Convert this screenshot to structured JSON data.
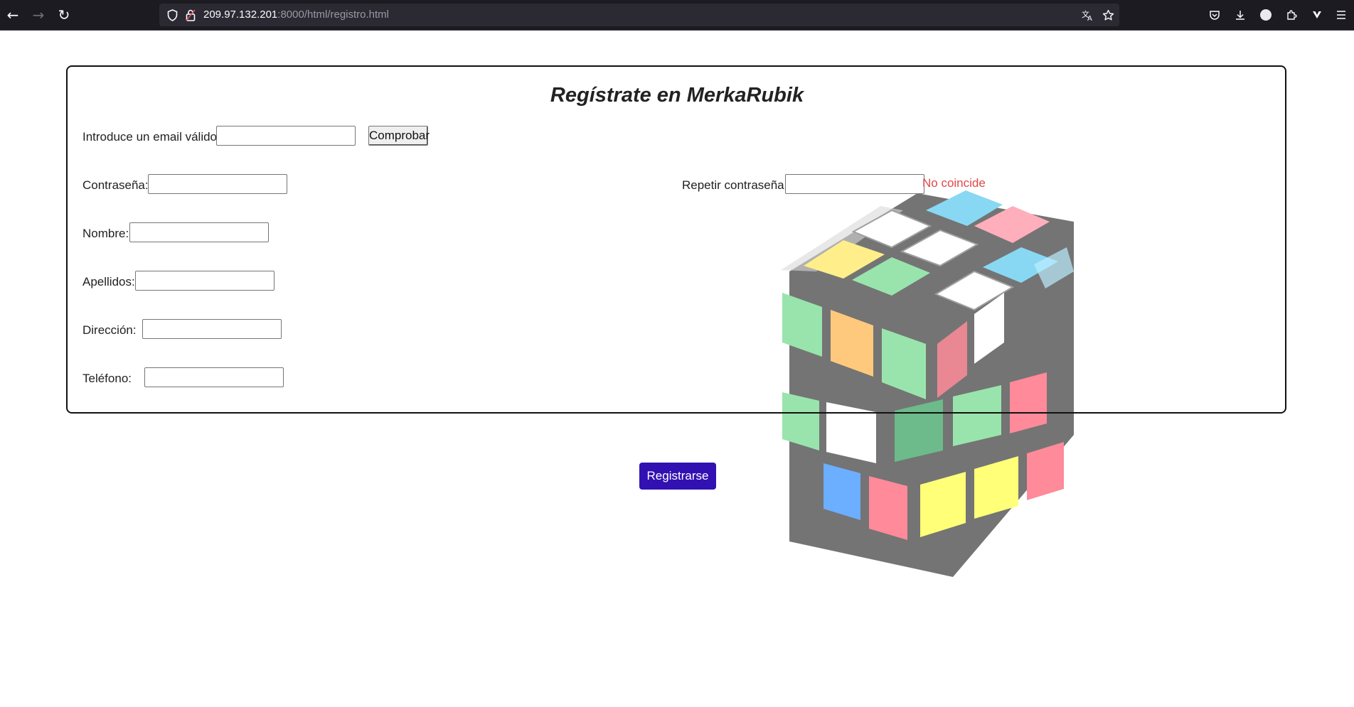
{
  "browser": {
    "url_host": "209.97.132.201",
    "url_rest": ":8000/html/registro.html",
    "nav": {
      "back_icon": "←",
      "forward_icon": "→",
      "reload_icon": "↻"
    },
    "toolbar_icons": [
      "translate-icon",
      "star-icon",
      "pocket-icon",
      "download-icon",
      "account-icon",
      "extensions-icon",
      "vpn-icon",
      "menu-icon"
    ]
  },
  "page": {
    "title": "Regístrate en MerkaRubik",
    "email": {
      "label": "Introduce un email válido:",
      "value": "",
      "check_button": "Comprobar"
    },
    "password": {
      "label": "Contraseña:",
      "value": ""
    },
    "repeat_password": {
      "label": "Repetir contraseña:",
      "value": "",
      "status": "No coincide"
    },
    "nombre": {
      "label": "Nombre:",
      "value": ""
    },
    "apellidos": {
      "label": "Apellidos:",
      "value": ""
    },
    "direccion": {
      "label": "Dirección:",
      "value": ""
    },
    "telefono": {
      "label": "Teléfono:",
      "value": ""
    },
    "submit_label": "Registrarse"
  },
  "colors": {
    "submit_bg": "#3211b2",
    "error_text": "#e04848",
    "chrome_bg": "#1c1b22"
  }
}
